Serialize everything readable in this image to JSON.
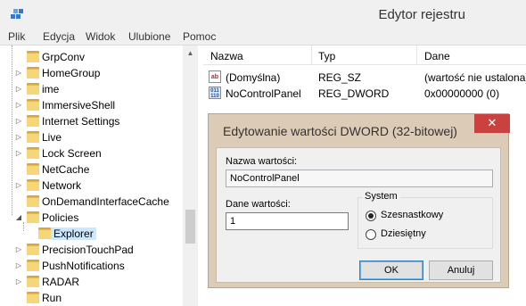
{
  "window": {
    "title": "Edytor rejestru"
  },
  "menu": [
    "Plik",
    "Edycja",
    "Widok",
    "Ulubione",
    "Pomoc"
  ],
  "tree": {
    "items": [
      {
        "label": "GrpConv",
        "expander": ""
      },
      {
        "label": "HomeGroup",
        "expander": "▷"
      },
      {
        "label": "ime",
        "expander": "▷"
      },
      {
        "label": "ImmersiveShell",
        "expander": "▷"
      },
      {
        "label": "Internet Settings",
        "expander": "▷"
      },
      {
        "label": "Live",
        "expander": "▷"
      },
      {
        "label": "Lock Screen",
        "expander": "▷"
      },
      {
        "label": "NetCache",
        "expander": ""
      },
      {
        "label": "Network",
        "expander": "▷"
      },
      {
        "label": "OnDemandInterfaceCache",
        "expander": ""
      },
      {
        "label": "Policies",
        "expander": "◢"
      },
      {
        "label": "Explorer",
        "expander": ""
      },
      {
        "label": "PrecisionTouchPad",
        "expander": "▷"
      },
      {
        "label": "PushNotifications",
        "expander": "▷"
      },
      {
        "label": "RADAR",
        "expander": "▷"
      },
      {
        "label": "Run",
        "expander": ""
      }
    ]
  },
  "list": {
    "columns": [
      "Nazwa",
      "Typ",
      "Dane"
    ],
    "rows": [
      {
        "icon": "ab",
        "name": "(Domyślna)",
        "type": "REG_SZ",
        "data": "(wartość nie ustalona)"
      },
      {
        "icon": "bin",
        "name": "NoControlPanel",
        "type": "REG_DWORD",
        "data": "0x00000000 (0)"
      }
    ]
  },
  "dialog": {
    "title": "Edytowanie wartości DWORD (32-bitowej)",
    "close_glyph": "✕",
    "name_label": "Nazwa wartości:",
    "name_value": "NoControlPanel",
    "data_label": "Dane wartości:",
    "data_value": "1",
    "base_group": "System",
    "radio_hex": "Szesnastkowy",
    "radio_dec": "Dziesiętny",
    "selected_base": "hex",
    "ok_label": "OK",
    "cancel_label": "Anuluj"
  },
  "colors": {
    "dialog_frame": "#dccbb6",
    "close_button": "#c9423f",
    "selection": "#cce8ff",
    "folder": "#f5d77a"
  }
}
